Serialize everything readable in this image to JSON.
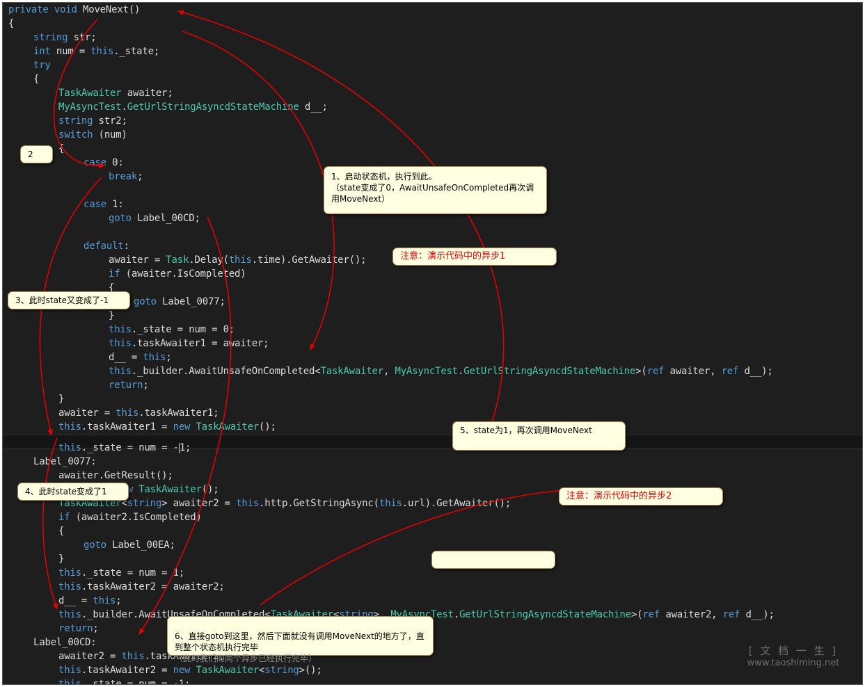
{
  "code_top": [
    {
      "indent": 0,
      "tokens": [
        [
          "kw",
          "private"
        ],
        [
          "pl",
          " "
        ],
        [
          "kw",
          "void"
        ],
        [
          "pl",
          " MoveNext()"
        ]
      ]
    },
    {
      "indent": 0,
      "tokens": [
        [
          "pl",
          "{"
        ]
      ]
    },
    {
      "indent": 1,
      "tokens": [
        [
          "kw",
          "string"
        ],
        [
          "pl",
          " str;"
        ]
      ]
    },
    {
      "indent": 1,
      "tokens": [
        [
          "kw",
          "int"
        ],
        [
          "pl",
          " num = "
        ],
        [
          "kw",
          "this"
        ],
        [
          "pl",
          "._state;"
        ]
      ]
    },
    {
      "indent": 1,
      "tokens": [
        [
          "kw",
          "try"
        ]
      ]
    },
    {
      "indent": 1,
      "tokens": [
        [
          "pl",
          "{"
        ]
      ]
    },
    {
      "indent": 2,
      "tokens": [
        [
          "ty",
          "TaskAwaiter"
        ],
        [
          "pl",
          " awaiter;"
        ]
      ]
    },
    {
      "indent": 2,
      "tokens": [
        [
          "ty",
          "MyAsyncTest"
        ],
        [
          "pl",
          "."
        ],
        [
          "ty",
          "GetUrlStringAsyncdStateMachine"
        ],
        [
          "pl",
          " d__;"
        ]
      ]
    },
    {
      "indent": 2,
      "tokens": [
        [
          "kw",
          "string"
        ],
        [
          "pl",
          " str2;"
        ]
      ]
    },
    {
      "indent": 2,
      "tokens": [
        [
          "kw",
          "switch"
        ],
        [
          "pl",
          " (num)"
        ]
      ]
    },
    {
      "indent": 2,
      "tokens": [
        [
          "pl",
          "{"
        ]
      ]
    },
    {
      "indent": 3,
      "tokens": [
        [
          "kw",
          "case"
        ],
        [
          "pl",
          " 0:"
        ]
      ]
    },
    {
      "indent": 4,
      "tokens": [
        [
          "kw",
          "break"
        ],
        [
          "pl",
          ";"
        ]
      ]
    },
    {
      "indent": 0,
      "tokens": []
    },
    {
      "indent": 3,
      "tokens": [
        [
          "kw",
          "case"
        ],
        [
          "pl",
          " 1:"
        ]
      ]
    },
    {
      "indent": 4,
      "tokens": [
        [
          "kw",
          "goto"
        ],
        [
          "pl",
          " Label_00CD;"
        ]
      ]
    },
    {
      "indent": 0,
      "tokens": []
    },
    {
      "indent": 3,
      "tokens": [
        [
          "kw",
          "default"
        ],
        [
          "pl",
          ":"
        ]
      ]
    },
    {
      "indent": 4,
      "tokens": [
        [
          "pl",
          "awaiter = "
        ],
        [
          "ty",
          "Task"
        ],
        [
          "pl",
          ".Delay("
        ],
        [
          "kw",
          "this"
        ],
        [
          "pl",
          ".time).GetAwaiter();"
        ]
      ]
    },
    {
      "indent": 4,
      "tokens": [
        [
          "kw",
          "if"
        ],
        [
          "pl",
          " (awaiter.IsCompleted)"
        ]
      ]
    },
    {
      "indent": 4,
      "tokens": [
        [
          "pl",
          "{"
        ]
      ]
    },
    {
      "indent": 5,
      "tokens": [
        [
          "kw",
          "goto"
        ],
        [
          "pl",
          " Label_0077;"
        ]
      ]
    },
    {
      "indent": 4,
      "tokens": [
        [
          "pl",
          "}"
        ]
      ]
    },
    {
      "indent": 4,
      "tokens": [
        [
          "kw",
          "this"
        ],
        [
          "pl",
          "._state = num = 0;"
        ]
      ]
    },
    {
      "indent": 4,
      "tokens": [
        [
          "kw",
          "this"
        ],
        [
          "pl",
          ".taskAwaiter1 = awaiter;"
        ]
      ]
    },
    {
      "indent": 4,
      "tokens": [
        [
          "pl",
          "d__ = "
        ],
        [
          "kw",
          "this"
        ],
        [
          "pl",
          ";"
        ]
      ]
    },
    {
      "indent": 4,
      "tokens": [
        [
          "kw",
          "this"
        ],
        [
          "pl",
          "._builder.AwaitUnsafeOnCompleted<"
        ],
        [
          "ty",
          "TaskAwaiter"
        ],
        [
          "pl",
          ", "
        ],
        [
          "ty",
          "MyAsyncTest"
        ],
        [
          "pl",
          "."
        ],
        [
          "ty",
          "GetUrlStringAsyncdStateMachine"
        ],
        [
          "pl",
          ">("
        ],
        [
          "kw",
          "ref"
        ],
        [
          "pl",
          " awaiter, "
        ],
        [
          "kw",
          "ref"
        ],
        [
          "pl",
          " d__);"
        ]
      ]
    },
    {
      "indent": 4,
      "tokens": [
        [
          "kw",
          "return"
        ],
        [
          "pl",
          ";"
        ]
      ]
    },
    {
      "indent": 2,
      "tokens": [
        [
          "pl",
          "}"
        ]
      ]
    },
    {
      "indent": 2,
      "tokens": [
        [
          "pl",
          "awaiter = "
        ],
        [
          "kw",
          "this"
        ],
        [
          "pl",
          ".taskAwaiter1;"
        ]
      ]
    },
    {
      "indent": 2,
      "tokens": [
        [
          "kw",
          "this"
        ],
        [
          "pl",
          ".taskAwaiter1 = "
        ],
        [
          "kw",
          "new"
        ],
        [
          "pl",
          " "
        ],
        [
          "ty",
          "TaskAwaiter"
        ],
        [
          "pl",
          "();"
        ]
      ]
    }
  ],
  "code_bottom": [
    {
      "indent": 2,
      "tokens": [
        [
          "kw",
          "this"
        ],
        [
          "pl",
          "._state = num = -"
        ],
        [
          "caret",
          ""
        ],
        [
          "pl",
          "1;"
        ]
      ]
    },
    {
      "indent": 1,
      "tokens": [
        [
          "pl",
          "Label_0077:"
        ]
      ]
    },
    {
      "indent": 2,
      "tokens": [
        [
          "pl",
          "awaiter.GetResult();"
        ]
      ]
    },
    {
      "indent": 2,
      "tokens": [
        [
          "pl",
          "awaiter = "
        ],
        [
          "kw",
          "new"
        ],
        [
          "pl",
          " "
        ],
        [
          "ty",
          "TaskAwaiter"
        ],
        [
          "pl",
          "();"
        ]
      ]
    },
    {
      "indent": 2,
      "tokens": [
        [
          "ty",
          "TaskAwaiter"
        ],
        [
          "pl",
          "<"
        ],
        [
          "kw",
          "string"
        ],
        [
          "pl",
          "> awaiter2 = "
        ],
        [
          "kw",
          "this"
        ],
        [
          "pl",
          ".http.GetStringAsync("
        ],
        [
          "kw",
          "this"
        ],
        [
          "pl",
          ".url).GetAwaiter();"
        ]
      ]
    },
    {
      "indent": 2,
      "tokens": [
        [
          "kw",
          "if"
        ],
        [
          "pl",
          " (awaiter2.IsCompleted)"
        ]
      ]
    },
    {
      "indent": 2,
      "tokens": [
        [
          "pl",
          "{"
        ]
      ]
    },
    {
      "indent": 3,
      "tokens": [
        [
          "kw",
          "goto"
        ],
        [
          "pl",
          " Label_00EA;"
        ]
      ]
    },
    {
      "indent": 2,
      "tokens": [
        [
          "pl",
          "}"
        ]
      ]
    },
    {
      "indent": 2,
      "tokens": [
        [
          "kw",
          "this"
        ],
        [
          "pl",
          "._state = num = 1;"
        ]
      ]
    },
    {
      "indent": 2,
      "tokens": [
        [
          "kw",
          "this"
        ],
        [
          "pl",
          ".taskAwaiter2 = awaiter2;"
        ]
      ]
    },
    {
      "indent": 2,
      "tokens": [
        [
          "pl",
          "d__ = "
        ],
        [
          "kw",
          "this"
        ],
        [
          "pl",
          ";"
        ]
      ]
    },
    {
      "indent": 2,
      "tokens": [
        [
          "kw",
          "this"
        ],
        [
          "pl",
          "._builder.AwaitUnsafeOnCompleted<"
        ],
        [
          "ty",
          "TaskAwaiter"
        ],
        [
          "pl",
          "<"
        ],
        [
          "kw",
          "string"
        ],
        [
          "pl",
          ">, "
        ],
        [
          "ty",
          "MyAsyncTest"
        ],
        [
          "pl",
          "."
        ],
        [
          "ty",
          "GetUrlStringAsyncdStateMachine"
        ],
        [
          "pl",
          ">("
        ],
        [
          "kw",
          "ref"
        ],
        [
          "pl",
          " awaiter2, "
        ],
        [
          "kw",
          "ref"
        ],
        [
          "pl",
          " d__);"
        ]
      ]
    },
    {
      "indent": 2,
      "tokens": [
        [
          "kw",
          "return"
        ],
        [
          "pl",
          ";"
        ]
      ]
    },
    {
      "indent": 1,
      "tokens": [
        [
          "pl",
          "Label_00CD:"
        ]
      ]
    },
    {
      "indent": 2,
      "tokens": [
        [
          "pl",
          "awaiter2 = "
        ],
        [
          "kw",
          "this"
        ],
        [
          "pl",
          ".taskAwaiter2;"
        ]
      ]
    },
    {
      "indent": 2,
      "tokens": [
        [
          "kw",
          "this"
        ],
        [
          "pl",
          ".taskAwaiter2 = "
        ],
        [
          "kw",
          "new"
        ],
        [
          "pl",
          " "
        ],
        [
          "ty",
          "TaskAwaiter"
        ],
        [
          "pl",
          "<"
        ],
        [
          "kw",
          "string"
        ],
        [
          "pl",
          ">();"
        ]
      ]
    },
    {
      "indent": 2,
      "tokens": [
        [
          "kw",
          "this"
        ],
        [
          "pl",
          "._state = num = -1;"
        ]
      ]
    }
  ],
  "annotations": {
    "note_2": "2",
    "note_1": "1、启动状态机，执行到此。\n（state变成了0，AwaitUnsafeOnCompleted再次调用MoveNext）",
    "note_async1": "注意：演示代码中的异步1",
    "note_3": "3、此时state又变成了-1",
    "note_5": "5、state为1，再次调用MoveNext",
    "note_4": "4、此时state变成了1",
    "note_async2": "注意：演示代码中的异步2",
    "note_blank": "",
    "note_6_main": "6、直接goto到这里，然后下面就没有调用MoveNext的地方了，直到整个状态机执行完毕",
    "note_6_sub": "（此时我们的两个异步已经执行完毕）"
  },
  "watermark": {
    "line1": "[ 文 档 一 生 ]",
    "line2": "www.taoshiming.net"
  },
  "colors": {
    "editor_bg": "#1e1e1e",
    "keyword": "#569cd6",
    "type": "#4ec9b0",
    "plain": "#dcdcdc",
    "arrow": "#e00000",
    "note_bg": "#ffffe1"
  }
}
